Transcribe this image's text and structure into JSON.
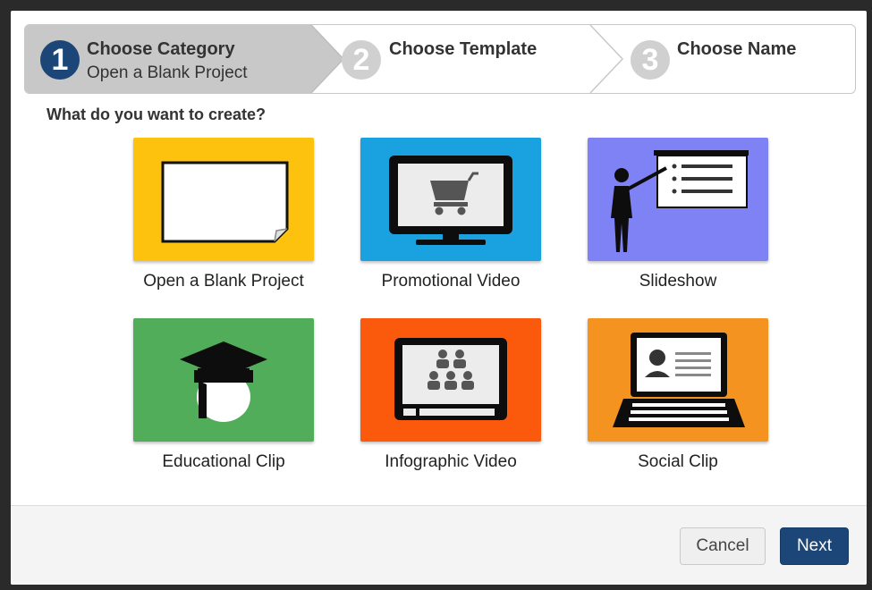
{
  "wizard": {
    "steps": [
      {
        "number": "1",
        "title": "Choose Category",
        "subtitle": "Open a Blank Project",
        "state": "active"
      },
      {
        "number": "2",
        "title": "Choose Template",
        "subtitle": "",
        "state": "inactive"
      },
      {
        "number": "3",
        "title": "Choose Name",
        "subtitle": "",
        "state": "inactive"
      }
    ]
  },
  "prompt": "What do you want to create?",
  "categories": [
    {
      "label": "Open a Blank Project",
      "color": "#fdc20d",
      "icon": "blank-page-icon"
    },
    {
      "label": "Promotional Video",
      "color": "#1aa1e0",
      "icon": "monitor-cart-icon"
    },
    {
      "label": "Slideshow",
      "color": "#7f82f4",
      "icon": "presenter-board-icon"
    },
    {
      "label": "Educational Clip",
      "color": "#52ad5b",
      "icon": "graduate-cap-icon"
    },
    {
      "label": "Infographic Video",
      "color": "#fb5a0d",
      "icon": "people-video-icon"
    },
    {
      "label": "Social Clip",
      "color": "#f49320",
      "icon": "laptop-profile-icon"
    }
  ],
  "footer": {
    "cancel_label": "Cancel",
    "next_label": "Next"
  },
  "colors": {
    "accent": "#1d4678",
    "active_step_bg": "#c8c8c8",
    "inactive_step_circle": "#d0d0d0"
  }
}
